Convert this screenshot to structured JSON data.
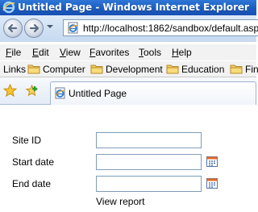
{
  "window": {
    "title": "Untitled Page - Windows Internet Explorer"
  },
  "address_bar": {
    "url": "http://localhost:1862/sandbox/default.aspx"
  },
  "menu": {
    "items": [
      {
        "first": "F",
        "rest": "ile"
      },
      {
        "first": "E",
        "rest": "dit"
      },
      {
        "first": "V",
        "rest": "iew"
      },
      {
        "first": "F",
        "rest": "avorites"
      },
      {
        "first": "T",
        "rest": "ools"
      },
      {
        "first": "H",
        "rest": "elp"
      }
    ]
  },
  "links_bar": {
    "label": "Links",
    "items": [
      "Computer",
      "Development",
      "Education",
      "Fin"
    ]
  },
  "tab": {
    "label": "Untitled Page"
  },
  "form": {
    "site_id_label": "Site ID",
    "start_date_label": "Start date",
    "end_date_label": "End date",
    "site_id_value": "",
    "start_date_value": "",
    "end_date_value": "",
    "view_report_label": "View report"
  },
  "icons": {
    "title_icon": "ie-logo-icon",
    "back": "back-arrow-icon",
    "forward": "forward-arrow-icon",
    "page": "ie-page-icon",
    "folder": "folder-icon",
    "favorites": "favorites-star-icon",
    "add_favorite": "add-favorite-icon",
    "calendar": "calendar-icon"
  },
  "colors": {
    "title_bar": "#1c5cc0",
    "input_border": "#7f9db9"
  }
}
